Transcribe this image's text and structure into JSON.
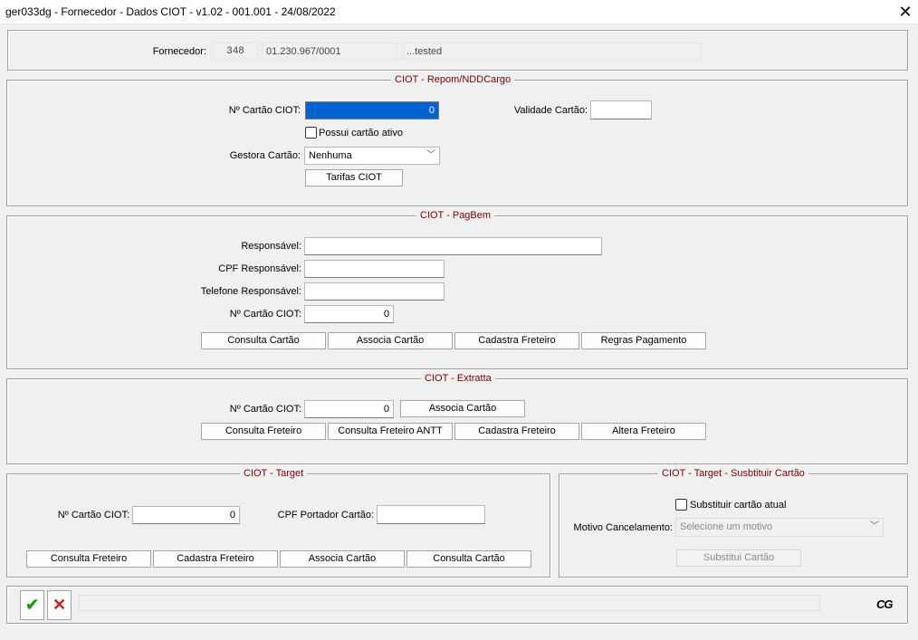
{
  "window": {
    "title": "ger033dg - Fornecedor - Dados CIOT - v1.02 - 001.001 - 24/08/2022",
    "close_icon": "close-icon"
  },
  "fornecedor": {
    "label": "Fornecedor:",
    "code": "348",
    "cnpj": "01.230.967/0001",
    "name": "...tested"
  },
  "repom": {
    "legend": "CIOT - Repom/NDDCargo",
    "cartao_label": "Nº Cartão CIOT:",
    "cartao_value": "0",
    "validade_label": "Validade Cartão:",
    "validade_value": "",
    "possui_label": "Possui cartão ativo",
    "possui_checked": false,
    "gestora_label": "Gestora Cartão:",
    "gestora_value": "Nenhuma",
    "tarifas_button": "Tarifas CIOT"
  },
  "pagbem": {
    "legend": "CIOT - PagBem",
    "responsavel_label": "Responsável:",
    "responsavel_value": "",
    "cpf_label": "CPF Responsável:",
    "cpf_value": "",
    "telefone_label": "Telefone Responsável:",
    "telefone_value": "",
    "cartao_label": "Nº Cartão CIOT:",
    "cartao_value": "0",
    "buttons": [
      "Consulta Cartão",
      "Associa Cartão",
      "Cadastra Freteiro",
      "Regras Pagamento"
    ]
  },
  "extratta": {
    "legend": "CIOT - Extratta",
    "cartao_label": "Nº Cartão CIOT:",
    "cartao_value": "0",
    "associa_button": "Associa Cartão",
    "buttons": [
      "Consulta Freteiro",
      "Consulta Freteiro ANTT",
      "Cadastra Freteiro",
      "Altera Freteiro"
    ]
  },
  "target": {
    "legend": "CIOT - Target",
    "cartao_label": "Nº Cartão CIOT:",
    "cartao_value": "0",
    "cpf_label": "CPF Portador Cartão:",
    "cpf_value": "",
    "buttons": [
      "Consulta Freteiro",
      "Cadastra Freteiro",
      "Associa Cartão",
      "Consulta Cartão"
    ]
  },
  "target_sub": {
    "legend": "CIOT - Target - Susbtituir Cartão",
    "substituir_label": "Substituir cartão atual",
    "substituir_checked": false,
    "motivo_label": "Motivo Cancelamento:",
    "motivo_placeholder": "Selecione um motivo",
    "substitui_button": "Substitui Cartão"
  },
  "footer": {
    "confirm_icon": "checkmark-icon",
    "cancel_icon": "cancel-x-icon",
    "logo": "CG",
    "colors": {
      "confirm": "#1a9c1a",
      "cancel": "#c81e1e"
    }
  }
}
